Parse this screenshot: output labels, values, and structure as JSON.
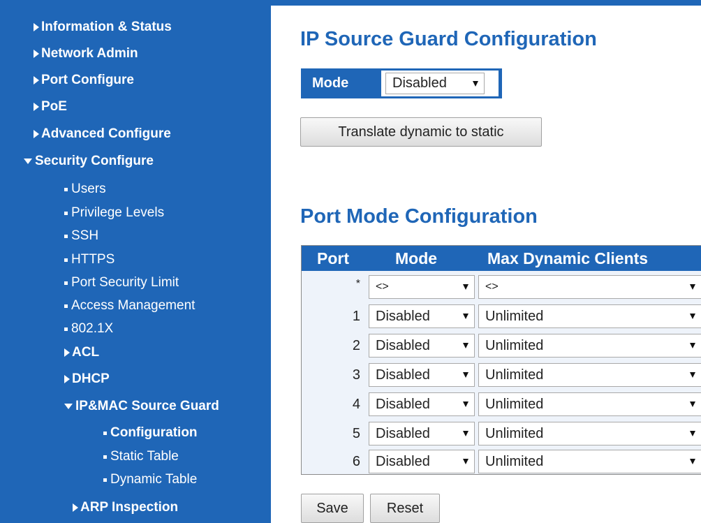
{
  "sidebar": {
    "items": [
      {
        "label": "Information & Status"
      },
      {
        "label": "Network Admin"
      },
      {
        "label": "Port Configure"
      },
      {
        "label": "PoE"
      },
      {
        "label": "Advanced Configure"
      },
      {
        "label": "Security Configure"
      },
      {
        "label": "Users"
      },
      {
        "label": "Privilege Levels"
      },
      {
        "label": "SSH"
      },
      {
        "label": "HTTPS"
      },
      {
        "label": "Port Security Limit"
      },
      {
        "label": "Access Management"
      },
      {
        "label": "802.1X"
      },
      {
        "label": "ACL"
      },
      {
        "label": "DHCP"
      },
      {
        "label": "IP&MAC Source Guard"
      },
      {
        "label": "Configuration"
      },
      {
        "label": "Static Table"
      },
      {
        "label": "Dynamic Table"
      },
      {
        "label": "ARP Inspection"
      }
    ]
  },
  "main": {
    "title": "IP Source Guard Configuration",
    "mode_label": "Mode",
    "mode_value": "Disabled",
    "translate_button": "Translate dynamic to static",
    "port_section_title": "Port Mode Configuration",
    "table": {
      "headers": [
        "Port",
        "Mode",
        "Max Dynamic Clients"
      ],
      "rows": [
        {
          "port": "*",
          "mode": "<>",
          "max": "<>"
        },
        {
          "port": "1",
          "mode": "Disabled",
          "max": "Unlimited"
        },
        {
          "port": "2",
          "mode": "Disabled",
          "max": "Unlimited"
        },
        {
          "port": "3",
          "mode": "Disabled",
          "max": "Unlimited"
        },
        {
          "port": "4",
          "mode": "Disabled",
          "max": "Unlimited"
        },
        {
          "port": "5",
          "mode": "Disabled",
          "max": "Unlimited"
        },
        {
          "port": "6",
          "mode": "Disabled",
          "max": "Unlimited"
        }
      ]
    },
    "save_button": "Save",
    "reset_button": "Reset"
  },
  "colors": {
    "brand_blue": "#1f66b7",
    "table_bg": "#eef3fa"
  }
}
